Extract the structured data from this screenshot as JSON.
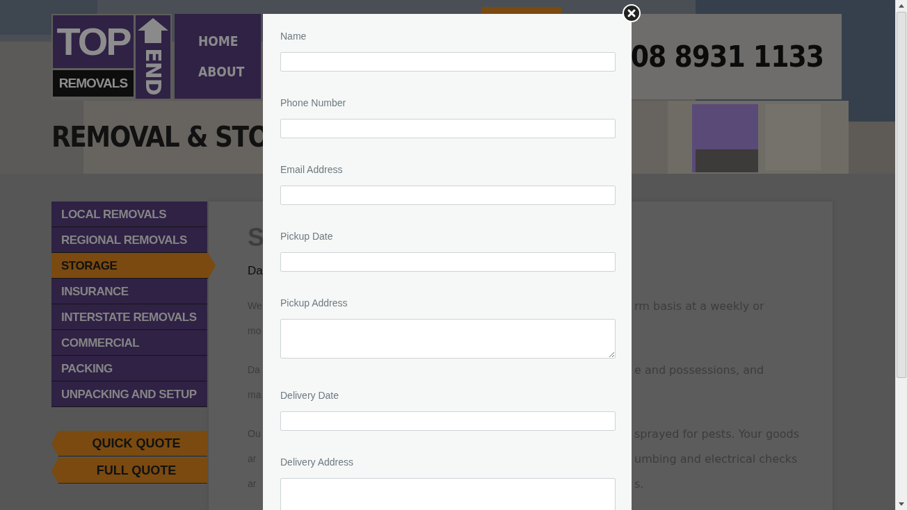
{
  "header": {
    "logo": {
      "top": "TOP",
      "bottom": "REMOVALS",
      "side": "END"
    },
    "nav": [
      {
        "label": "HOME"
      },
      {
        "label": "ABOUT"
      }
    ],
    "phone": "08 8931 1133",
    "title": "REMOVAL & STO"
  },
  "sidebar": {
    "items": [
      {
        "label": "LOCAL REMOVALS",
        "selected": false
      },
      {
        "label": "REGIONAL REMOVALS",
        "selected": false
      },
      {
        "label": "STORAGE",
        "selected": true
      },
      {
        "label": "INSURANCE",
        "selected": false
      },
      {
        "label": "INTERSTATE REMOVALS",
        "selected": false
      },
      {
        "label": "COMMERCIAL",
        "selected": false
      },
      {
        "label": "PACKING",
        "selected": false
      },
      {
        "label": "UNPACKING AND SETUP",
        "selected": false
      }
    ],
    "quote_buttons": [
      "QUICK QUOTE",
      "FULL QUOTE"
    ]
  },
  "content": {
    "heading": "S",
    "subheading": "Da",
    "paragraphs": [
      [
        {
          "left": "We",
          "right": "rm basis at a weekly or"
        },
        {
          "left": "mo"
        }
      ],
      [
        {
          "left": "Da",
          "right": "e and possessions, and"
        },
        {
          "left": "ma"
        }
      ],
      [
        {
          "left": "Ou",
          "right": "sprayed for pests. Your goods"
        },
        {
          "left": "ar",
          "right": "umbing and electrical checks"
        },
        {
          "left": "ar",
          "right": "s."
        }
      ]
    ]
  },
  "modal": {
    "fields": [
      {
        "label": "Name",
        "kind": "input"
      },
      {
        "label": "Phone Number",
        "kind": "input"
      },
      {
        "label": "Email Address",
        "kind": "input"
      },
      {
        "label": "Pickup Date",
        "kind": "input"
      },
      {
        "label": "Pickup Address",
        "kind": "textarea"
      },
      {
        "label": "Delivery Date",
        "kind": "input"
      },
      {
        "label": "Delivery Address",
        "kind": "textarea"
      }
    ]
  }
}
